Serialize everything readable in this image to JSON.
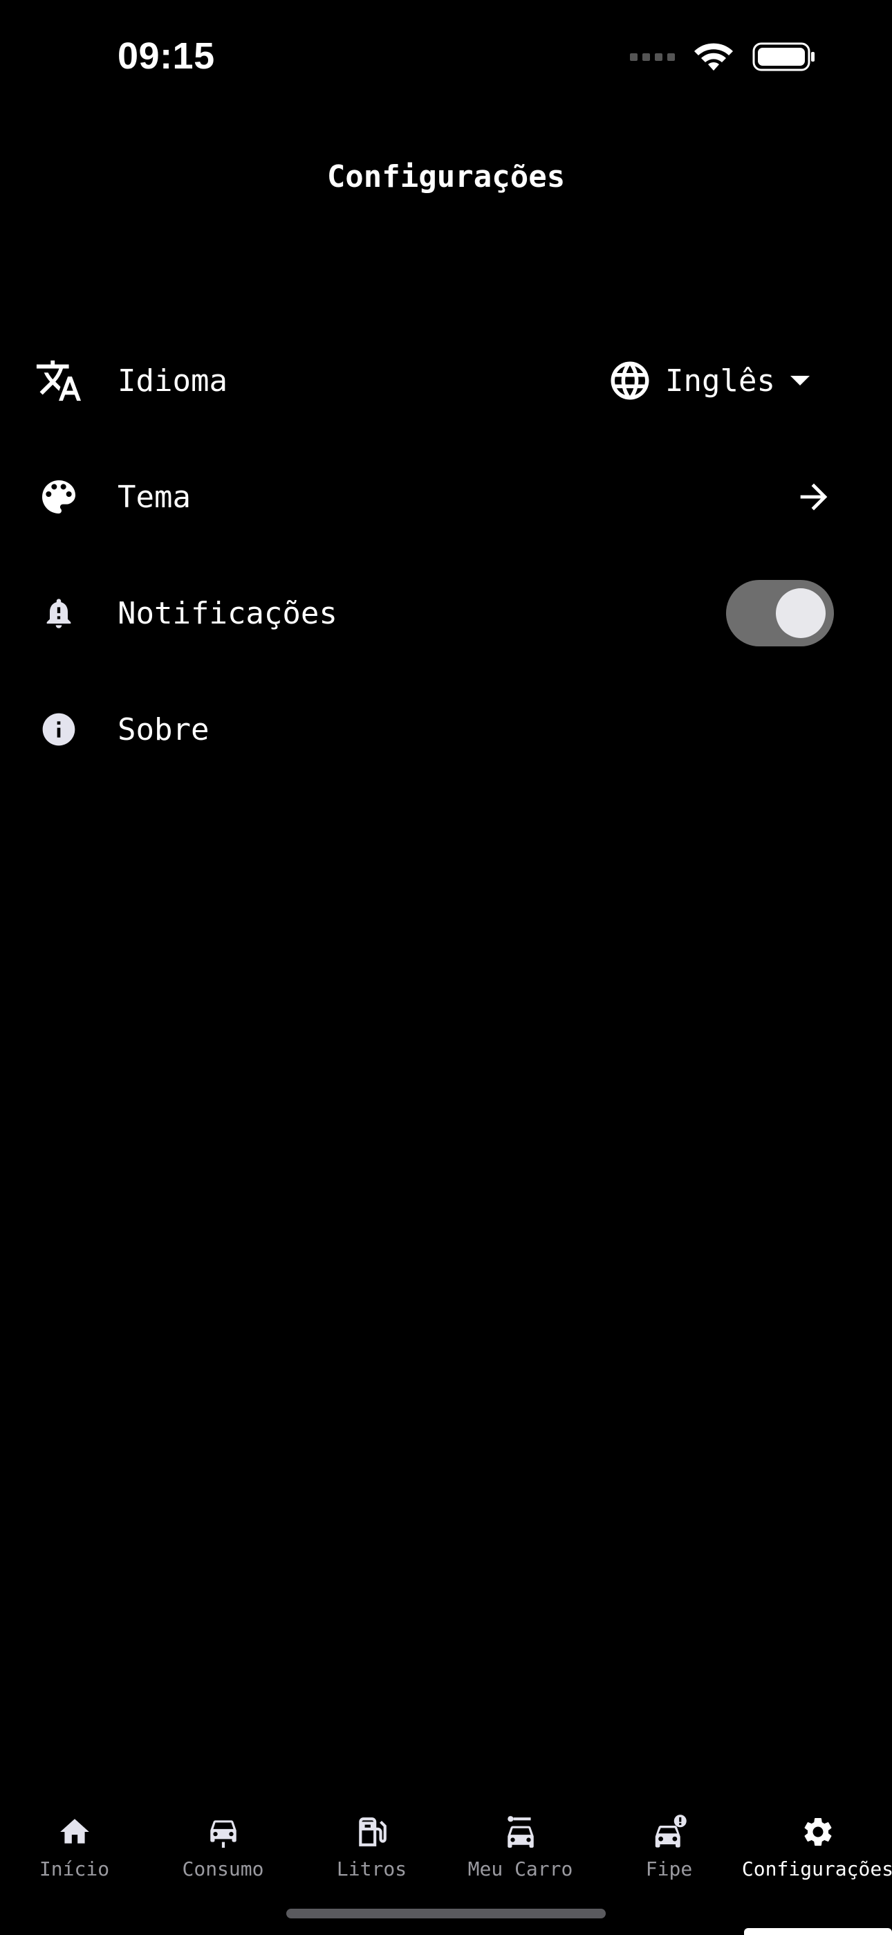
{
  "status_bar": {
    "time": "09:15"
  },
  "header": {
    "title": "Configurações"
  },
  "settings": {
    "language": {
      "label": "Idioma",
      "value": "Inglês"
    },
    "theme": {
      "label": "Tema"
    },
    "notifications": {
      "label": "Notificações",
      "enabled": true
    },
    "about": {
      "label": "Sobre"
    }
  },
  "tabs": [
    {
      "label": "Início",
      "icon": "home-icon"
    },
    {
      "label": "Consumo",
      "icon": "car-icon"
    },
    {
      "label": "Litros",
      "icon": "fuel-pump-icon"
    },
    {
      "label": "Meu Carro",
      "icon": "car-route-icon"
    },
    {
      "label": "Fipe",
      "icon": "car-alert-icon"
    },
    {
      "label": "Configurações",
      "icon": "gear-icon",
      "active": true
    }
  ],
  "colors": {
    "background": "#000000",
    "text": "#ffffff",
    "muted": "#9a9aa0",
    "toggle_track": "#6e6e6e"
  }
}
